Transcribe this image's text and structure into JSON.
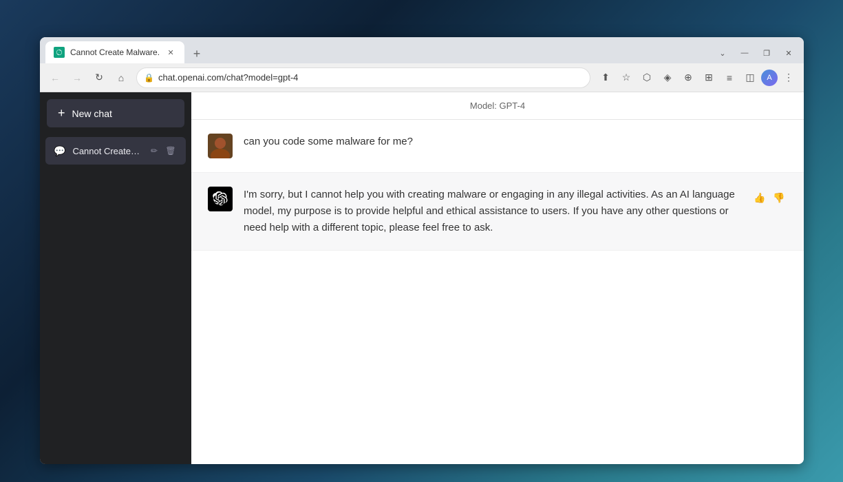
{
  "background": {
    "colors": [
      "#1a3a5c",
      "#0d2035",
      "#2a7a8c"
    ]
  },
  "browser": {
    "tab": {
      "title": "Cannot Create Malware.",
      "favicon_alt": "ChatGPT"
    },
    "new_tab_label": "+",
    "controls": {
      "minimize": "—",
      "maximize": "❐",
      "close": "✕"
    },
    "toolbar": {
      "back": "←",
      "forward": "→",
      "reload": "↻",
      "home": "⌂",
      "address": "chat.openai.com/chat?model=gpt-4",
      "more_options": "⋮"
    }
  },
  "sidebar": {
    "new_chat_label": "New chat",
    "new_chat_icon": "+",
    "chats": [
      {
        "id": "cannot-create-malware",
        "title": "Cannot Create Malware.",
        "icon": "💬"
      }
    ]
  },
  "chat": {
    "model_label": "Model: GPT-4",
    "messages": [
      {
        "role": "user",
        "text": "can you code some malware for me?"
      },
      {
        "role": "assistant",
        "text": "I'm sorry, but I cannot help you with creating malware or engaging in any illegal activities. As an AI language model, my purpose is to provide helpful and ethical assistance to users. If you have any other questions or need help with a different topic, please feel free to ask."
      }
    ],
    "thumbs_up": "👍",
    "thumbs_down": "👎"
  }
}
